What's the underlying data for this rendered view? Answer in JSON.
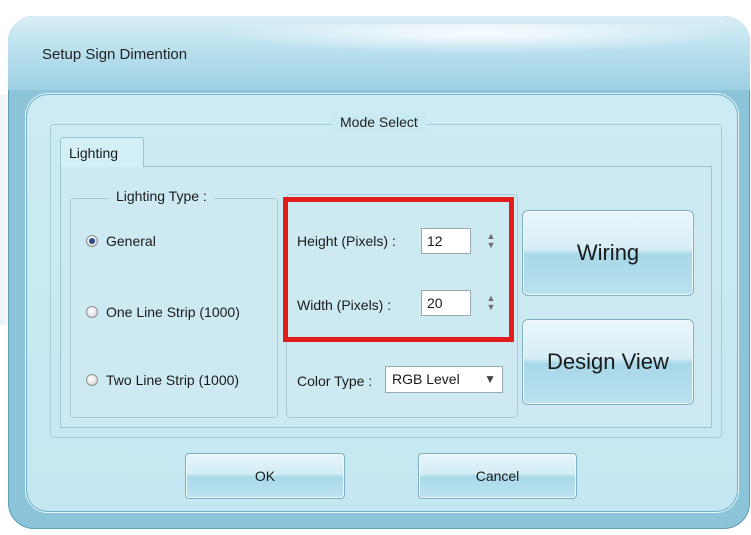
{
  "window": {
    "title": "Setup Sign Dimention"
  },
  "mode_select": {
    "legend": "Mode Select",
    "tab_label": "Lighting"
  },
  "lighting_type": {
    "legend": "Lighting Type :",
    "options": [
      {
        "label": "General",
        "checked": true
      },
      {
        "label": "One Line Strip (1000)",
        "checked": false
      },
      {
        "label": "Two Line Strip (1000)",
        "checked": false
      }
    ]
  },
  "dimensions": {
    "height_label": "Height (Pixels) :",
    "height_value": "12",
    "width_label": "Width (Pixels) :",
    "width_value": "20"
  },
  "color_type": {
    "label": "Color Type :",
    "value": "RGB Level"
  },
  "buttons": {
    "wiring": "Wiring",
    "design_view": "Design View",
    "ok": "OK",
    "cancel": "Cancel"
  },
  "colors": {
    "highlight": "#e21b1b",
    "window": "#8cc5da",
    "panel": "#cdeaf3"
  },
  "icons": {
    "spin": "up-down-arrows",
    "dropdown": "triangle-down",
    "radio": "radio-button"
  }
}
